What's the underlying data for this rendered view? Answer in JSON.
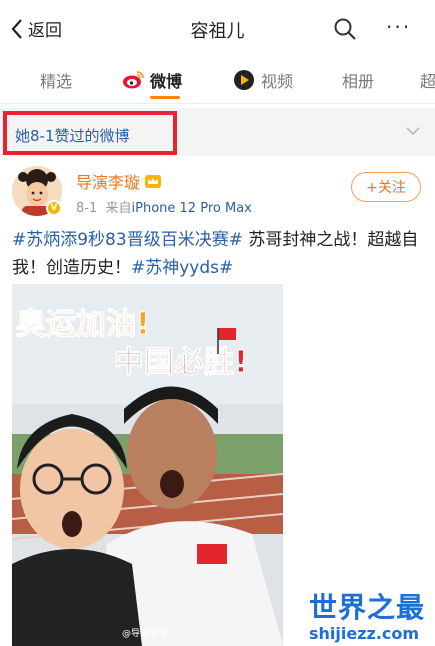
{
  "nav": {
    "back_label": "返回",
    "title": "容祖儿",
    "more_glyph": "···"
  },
  "tabs": [
    {
      "label": "精选"
    },
    {
      "label": "微博"
    },
    {
      "label": "视频"
    },
    {
      "label": "相册"
    },
    {
      "label": "超"
    }
  ],
  "filter": {
    "label": "她8-1赞过的微博"
  },
  "post": {
    "username": "导演李璇",
    "date": "8-1",
    "source_prefix": "来自",
    "device": "iPhone 12 Pro Max",
    "follow_label": "+关注",
    "text": {
      "tag1": "#苏炳添9秒83晋级百米决赛#",
      "mid": " 苏哥封神之战！超越自我！创造历史！",
      "tag2": "#苏神yyds#"
    },
    "photo": {
      "banner_line1": "奥运加油!",
      "banner_line2": "中国必胜!",
      "credit": "@导演李璇"
    }
  },
  "watermark": {
    "line1": "世界之最",
    "line2": "shijiezz.com"
  },
  "colors": {
    "accent_orange": "#ff8200",
    "link_blue": "#2a5fa8",
    "highlight_red": "#e8222f"
  }
}
